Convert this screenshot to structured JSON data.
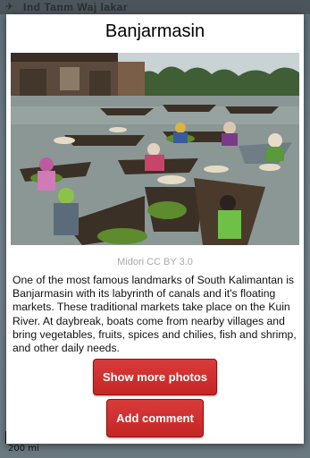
{
  "map": {
    "top_text": "Ind  Tanm Waj lakar",
    "scale_label": "200 mi"
  },
  "dialog": {
    "title": "Banjarmasin",
    "photo_alt": "Floating market boats on the river",
    "caption": "Midori CC BY 3.0",
    "description": "One of the most famous landmarks of South Kalimantan is Banjarmasin with its labyrinth of canals and it's floating markets. These traditional markets take place on the Kuin River. At daybreak, boats come from nearby villages and bring vegetables, fruits, spices and chilies, fish and shrimp, and other daily needs.",
    "show_more_label": "Show more photos",
    "add_comment_label": "Add comment"
  },
  "icons": {
    "map_icon": "map-pin-icon"
  },
  "colors": {
    "button": "#c42626",
    "caption": "#a9a9a9"
  }
}
